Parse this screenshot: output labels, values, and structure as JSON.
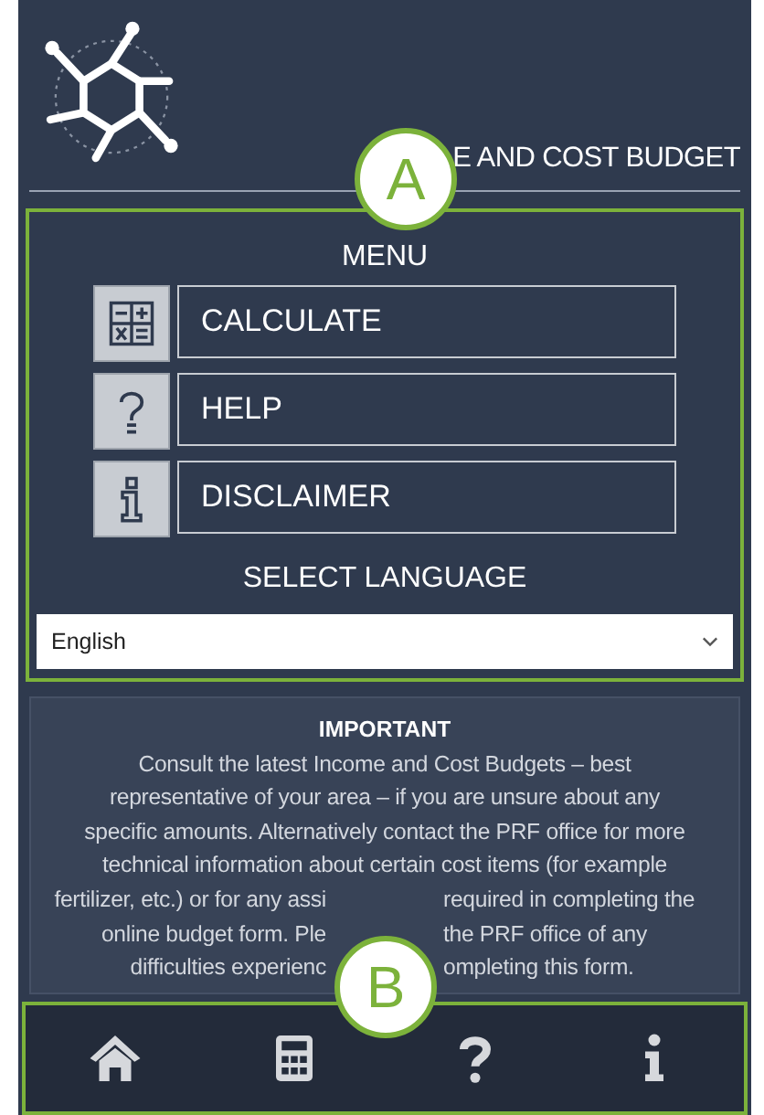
{
  "header": {
    "title_fragment": "E AND COST BUDGET"
  },
  "callouts": [
    {
      "label": "A"
    },
    {
      "label": "B"
    }
  ],
  "menu": {
    "title": "MENU",
    "items": [
      {
        "kind": "calculator",
        "label": "CALCULATE"
      },
      {
        "kind": "help",
        "label": "HELP"
      },
      {
        "kind": "info",
        "label": "DISCLAIMER"
      }
    ],
    "language_label": "SELECT LANGUAGE",
    "language_select": {
      "value": "English"
    }
  },
  "notice": {
    "title": "IMPORTANT",
    "lines": [
      {
        "segments": [
          "Consult the latest Income and Cost Budgets – best"
        ]
      },
      {
        "segments": [
          "representative of your area – if you are unsure about any"
        ]
      },
      {
        "segments": [
          "specific amounts. Alternatively contact the PRF office for more"
        ]
      },
      {
        "segments": [
          "technical information about certain cost items (for example"
        ]
      },
      {
        "segments": [
          "fertilizer, etc.) or for any assi",
          "required in completing the"
        ]
      },
      {
        "segments": [
          "online budget form. Ple",
          "the PRF office of any"
        ]
      },
      {
        "segments": [
          "difficulties experienc",
          "ompleting this form."
        ]
      }
    ]
  },
  "bottom_nav": {
    "items": [
      {
        "kind": "home"
      },
      {
        "kind": "calculator"
      },
      {
        "kind": "help"
      },
      {
        "kind": "info"
      }
    ]
  }
}
